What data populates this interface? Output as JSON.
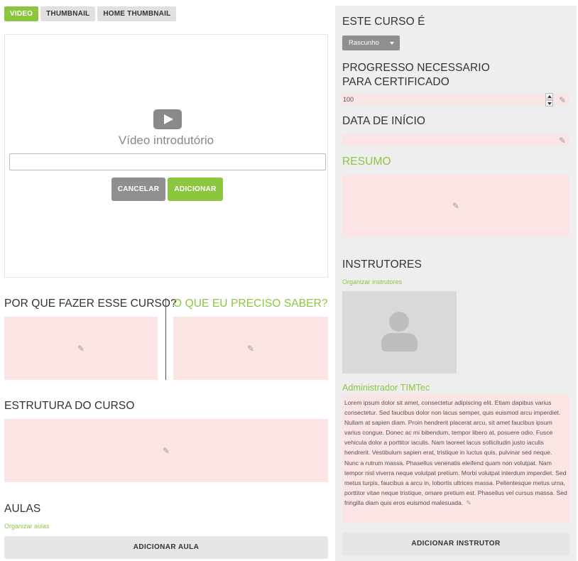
{
  "tabs": [
    {
      "label": "VIDEO",
      "active": true
    },
    {
      "label": "THUMBNAIL",
      "active": false
    },
    {
      "label": "HOME THUMBNAIL",
      "active": false
    }
  ],
  "video": {
    "title": "Vídeo introdutório",
    "input_value": "",
    "cancel_label": "CANCELAR",
    "add_label": "ADICIONAR"
  },
  "sections": {
    "why": "POR QUE FAZER ESSE CURSO?",
    "what": "O QUE EU PRECISO SABER?",
    "structure": "ESTRUTURA DO CURSO",
    "lessons": "AULAS",
    "organize_lessons": "Organizar aulas",
    "add_lesson": "ADICIONAR AULA"
  },
  "sidebar": {
    "status_title": "ESTE CURSO É",
    "status_value": "Rascunho",
    "progress_title": "PROGRESSO NECESSARIO PARA CERTIFICADO",
    "progress_value": "100",
    "start_date_title": "DATA DE INÍCIO",
    "start_date_value": "",
    "summary_title": "RESUMO",
    "instructors_title": "INSTRUTORES",
    "organize_instructors": "Organizar instrutores",
    "instructor_name": "Administrador TIMTec",
    "instructor_bio": "Lorem ipsum dolor sit amet, consectetur adipiscing elit. Etiam dapibus varius consectetur. Sed faucibus dolor non lacus semper, quis euismod arcu imperdiet. Nullam at sapien diam. Proin hendrerit placerat arcu, sit amet faucibus ipsum varius congue. Donec ac mi bibendum, tempor libero at, posuere odio. Fusce vehicula dolor a porttitor iaculis. Nam laoreet lacus sollicitudin justo iaculis hendrerit. Vestibulum sapien erat, tristique in luctus quis, pulvinar sed neque. Nunc a rutrum massa. Phasellus venenatis eleifend quam non volutpat. Nam tempor nisl viverra neque volutpat pretium. Morbi volutpat interdum imperdiet. Sed metus turpis, faucibus a arcu in, lobortis ultrices massa. Pellentesque metus urna, porttitor vitae neque tristique, ornare pretium est. Phasellus vel cursus massa. Sed fringilla diam quis eros euismod malesuada.",
    "add_instructor": "ADICIONAR INSTRUTOR"
  },
  "icons": {
    "edit": "pencil-icon",
    "play": "play-icon",
    "avatar": "user-placeholder-icon",
    "dropdown": "caret-down-icon"
  },
  "colors": {
    "accent": "#8cc63f",
    "editable_bg": "#fbe4e4",
    "sidebar_bg": "#eeeeee",
    "secondary_button": "#8f8f8f"
  }
}
